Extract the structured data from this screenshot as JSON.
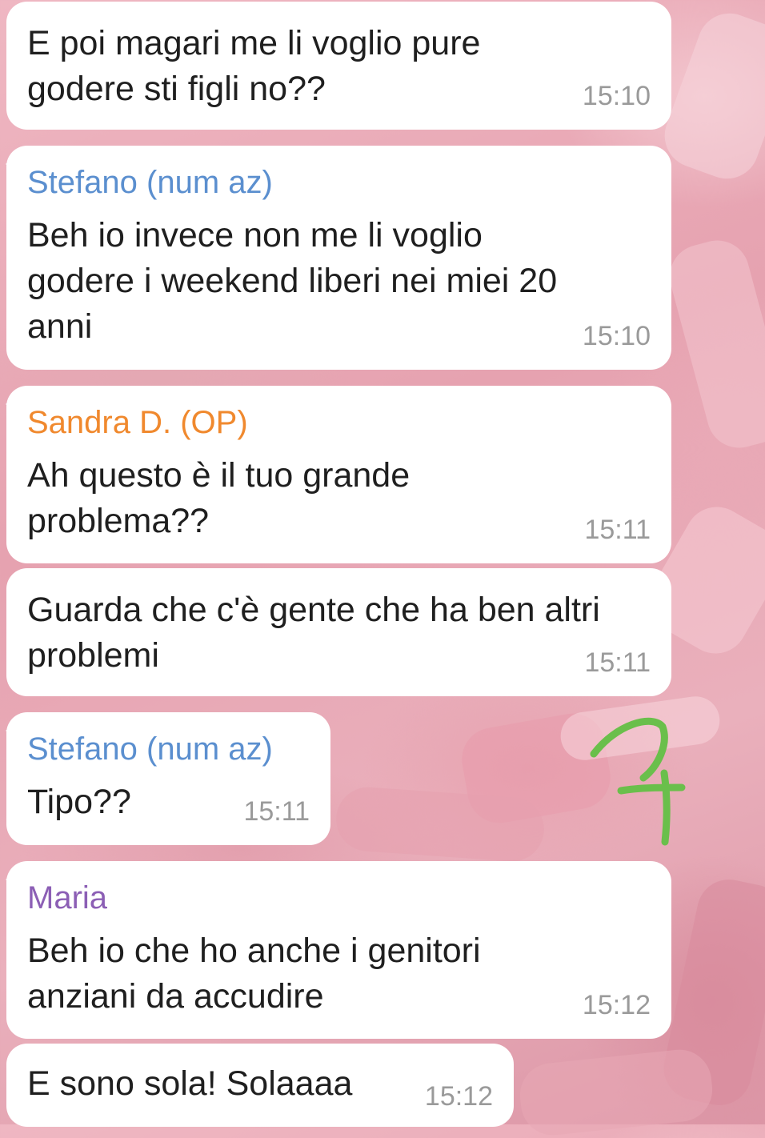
{
  "messages": [
    {
      "sender": "",
      "text": "E poi magari me li voglio pure\ngodere sti figli no??",
      "time": "15:10"
    },
    {
      "sender": "Stefano (num az)",
      "sender_color": "#5b8fcf",
      "text": "Beh io invece non me li voglio\ngodere i weekend liberi nei miei 20\nanni",
      "time": "15:10"
    },
    {
      "sender": "Sandra D. (OP)",
      "sender_color": "#f0892e",
      "text": "Ah questo è il tuo grande\nproblema??",
      "time": "15:11"
    },
    {
      "sender": "",
      "text": "Guarda che c'è gente che ha ben altri\nproblemi",
      "time": "15:11"
    },
    {
      "sender": "Stefano (num az)",
      "sender_color": "#5b8fcf",
      "text": "Tipo??",
      "time": "15:11"
    },
    {
      "sender": "Maria",
      "sender_color": "#8c5fb5",
      "text": "Beh io che ho anche i genitori\nanziani da accudire",
      "time": "15:12"
    },
    {
      "sender": "",
      "text": "E sono sola! Solaaaa",
      "time": "15:12"
    }
  ],
  "annotation": {
    "stroke_color": "#6abf4b"
  }
}
